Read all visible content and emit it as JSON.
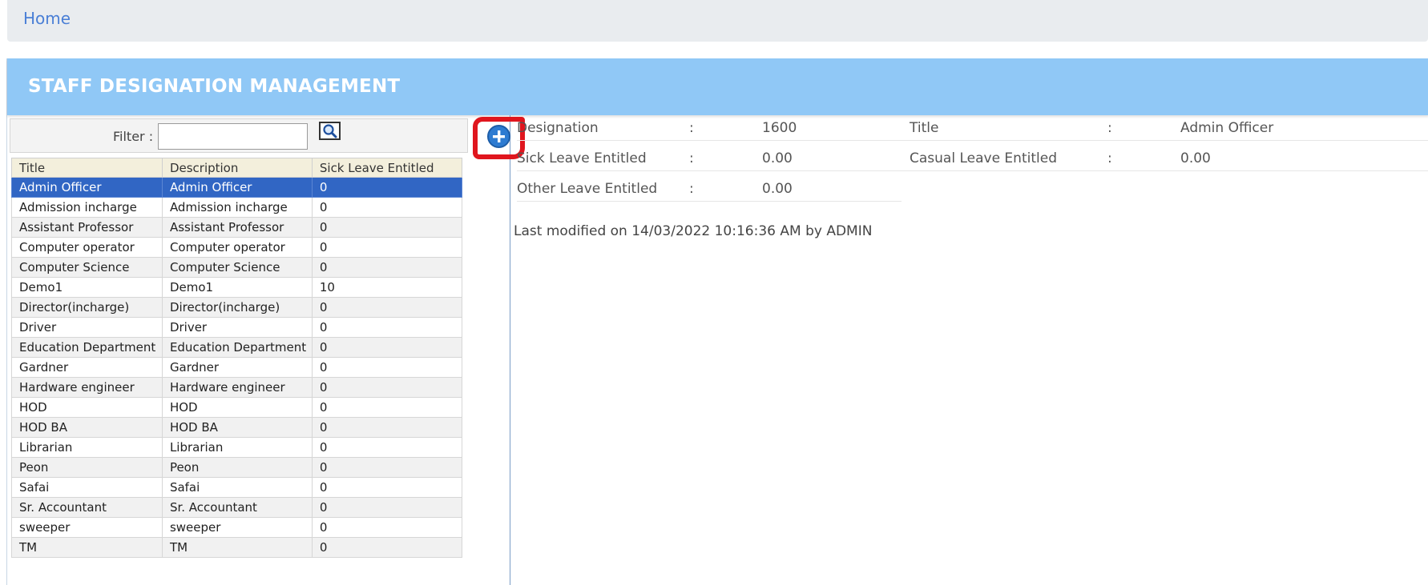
{
  "breadcrumb": {
    "home": "Home"
  },
  "panel": {
    "title": "STAFF DESIGNATION MANAGEMENT"
  },
  "filter": {
    "label": "Filter :",
    "value": "",
    "placeholder": ""
  },
  "icons": {
    "search": "search-icon",
    "add": "plus-circle-icon"
  },
  "colors": {
    "header": "#90c8f6",
    "selected_row": "#3166c4",
    "highlight": "#e0161e",
    "link": "#4a7fd6"
  },
  "table": {
    "columns": [
      "Title",
      "Description",
      "Sick Leave Entitled"
    ],
    "rows": [
      [
        "Admin Officer",
        "Admin Officer",
        "0"
      ],
      [
        "Admission incharge",
        "Admission incharge",
        "0"
      ],
      [
        "Assistant Professor",
        "Assistant Professor",
        "0"
      ],
      [
        "Computer operator",
        "Computer operator",
        "0"
      ],
      [
        "Computer Science",
        "Computer Science",
        "0"
      ],
      [
        "Demo1",
        "Demo1",
        "10"
      ],
      [
        "Director(incharge)",
        "Director(incharge)",
        "0"
      ],
      [
        "Driver",
        "Driver",
        "0"
      ],
      [
        "Education Department",
        "Education Department",
        "0"
      ],
      [
        "Gardner",
        "Gardner",
        "0"
      ],
      [
        "Hardware engineer",
        "Hardware engineer",
        "0"
      ],
      [
        "HOD",
        "HOD",
        "0"
      ],
      [
        "HOD BA",
        "HOD BA",
        "0"
      ],
      [
        "Librarian",
        "Librarian",
        "0"
      ],
      [
        "Peon",
        "Peon",
        "0"
      ],
      [
        "Safai",
        "Safai",
        "0"
      ],
      [
        "Sr. Accountant",
        "Sr. Accountant",
        "0"
      ],
      [
        "sweeper",
        "sweeper",
        "0"
      ],
      [
        "TM",
        "TM",
        "0"
      ]
    ],
    "selected_index": 0
  },
  "detail": {
    "designation_label": "Designation",
    "designation_value": "1600",
    "title_label": "Title",
    "title_value": "Admin Officer",
    "sick_label": "Sick Leave Entitled",
    "sick_value": "0.00",
    "casual_label": "Casual Leave Entitled",
    "casual_value": "0.00",
    "other_label": "Other Leave Entitled",
    "other_value": "0.00",
    "colon": ":",
    "last_modified": "Last modified on 14/03/2022 10:16:36 AM by ADMIN"
  }
}
